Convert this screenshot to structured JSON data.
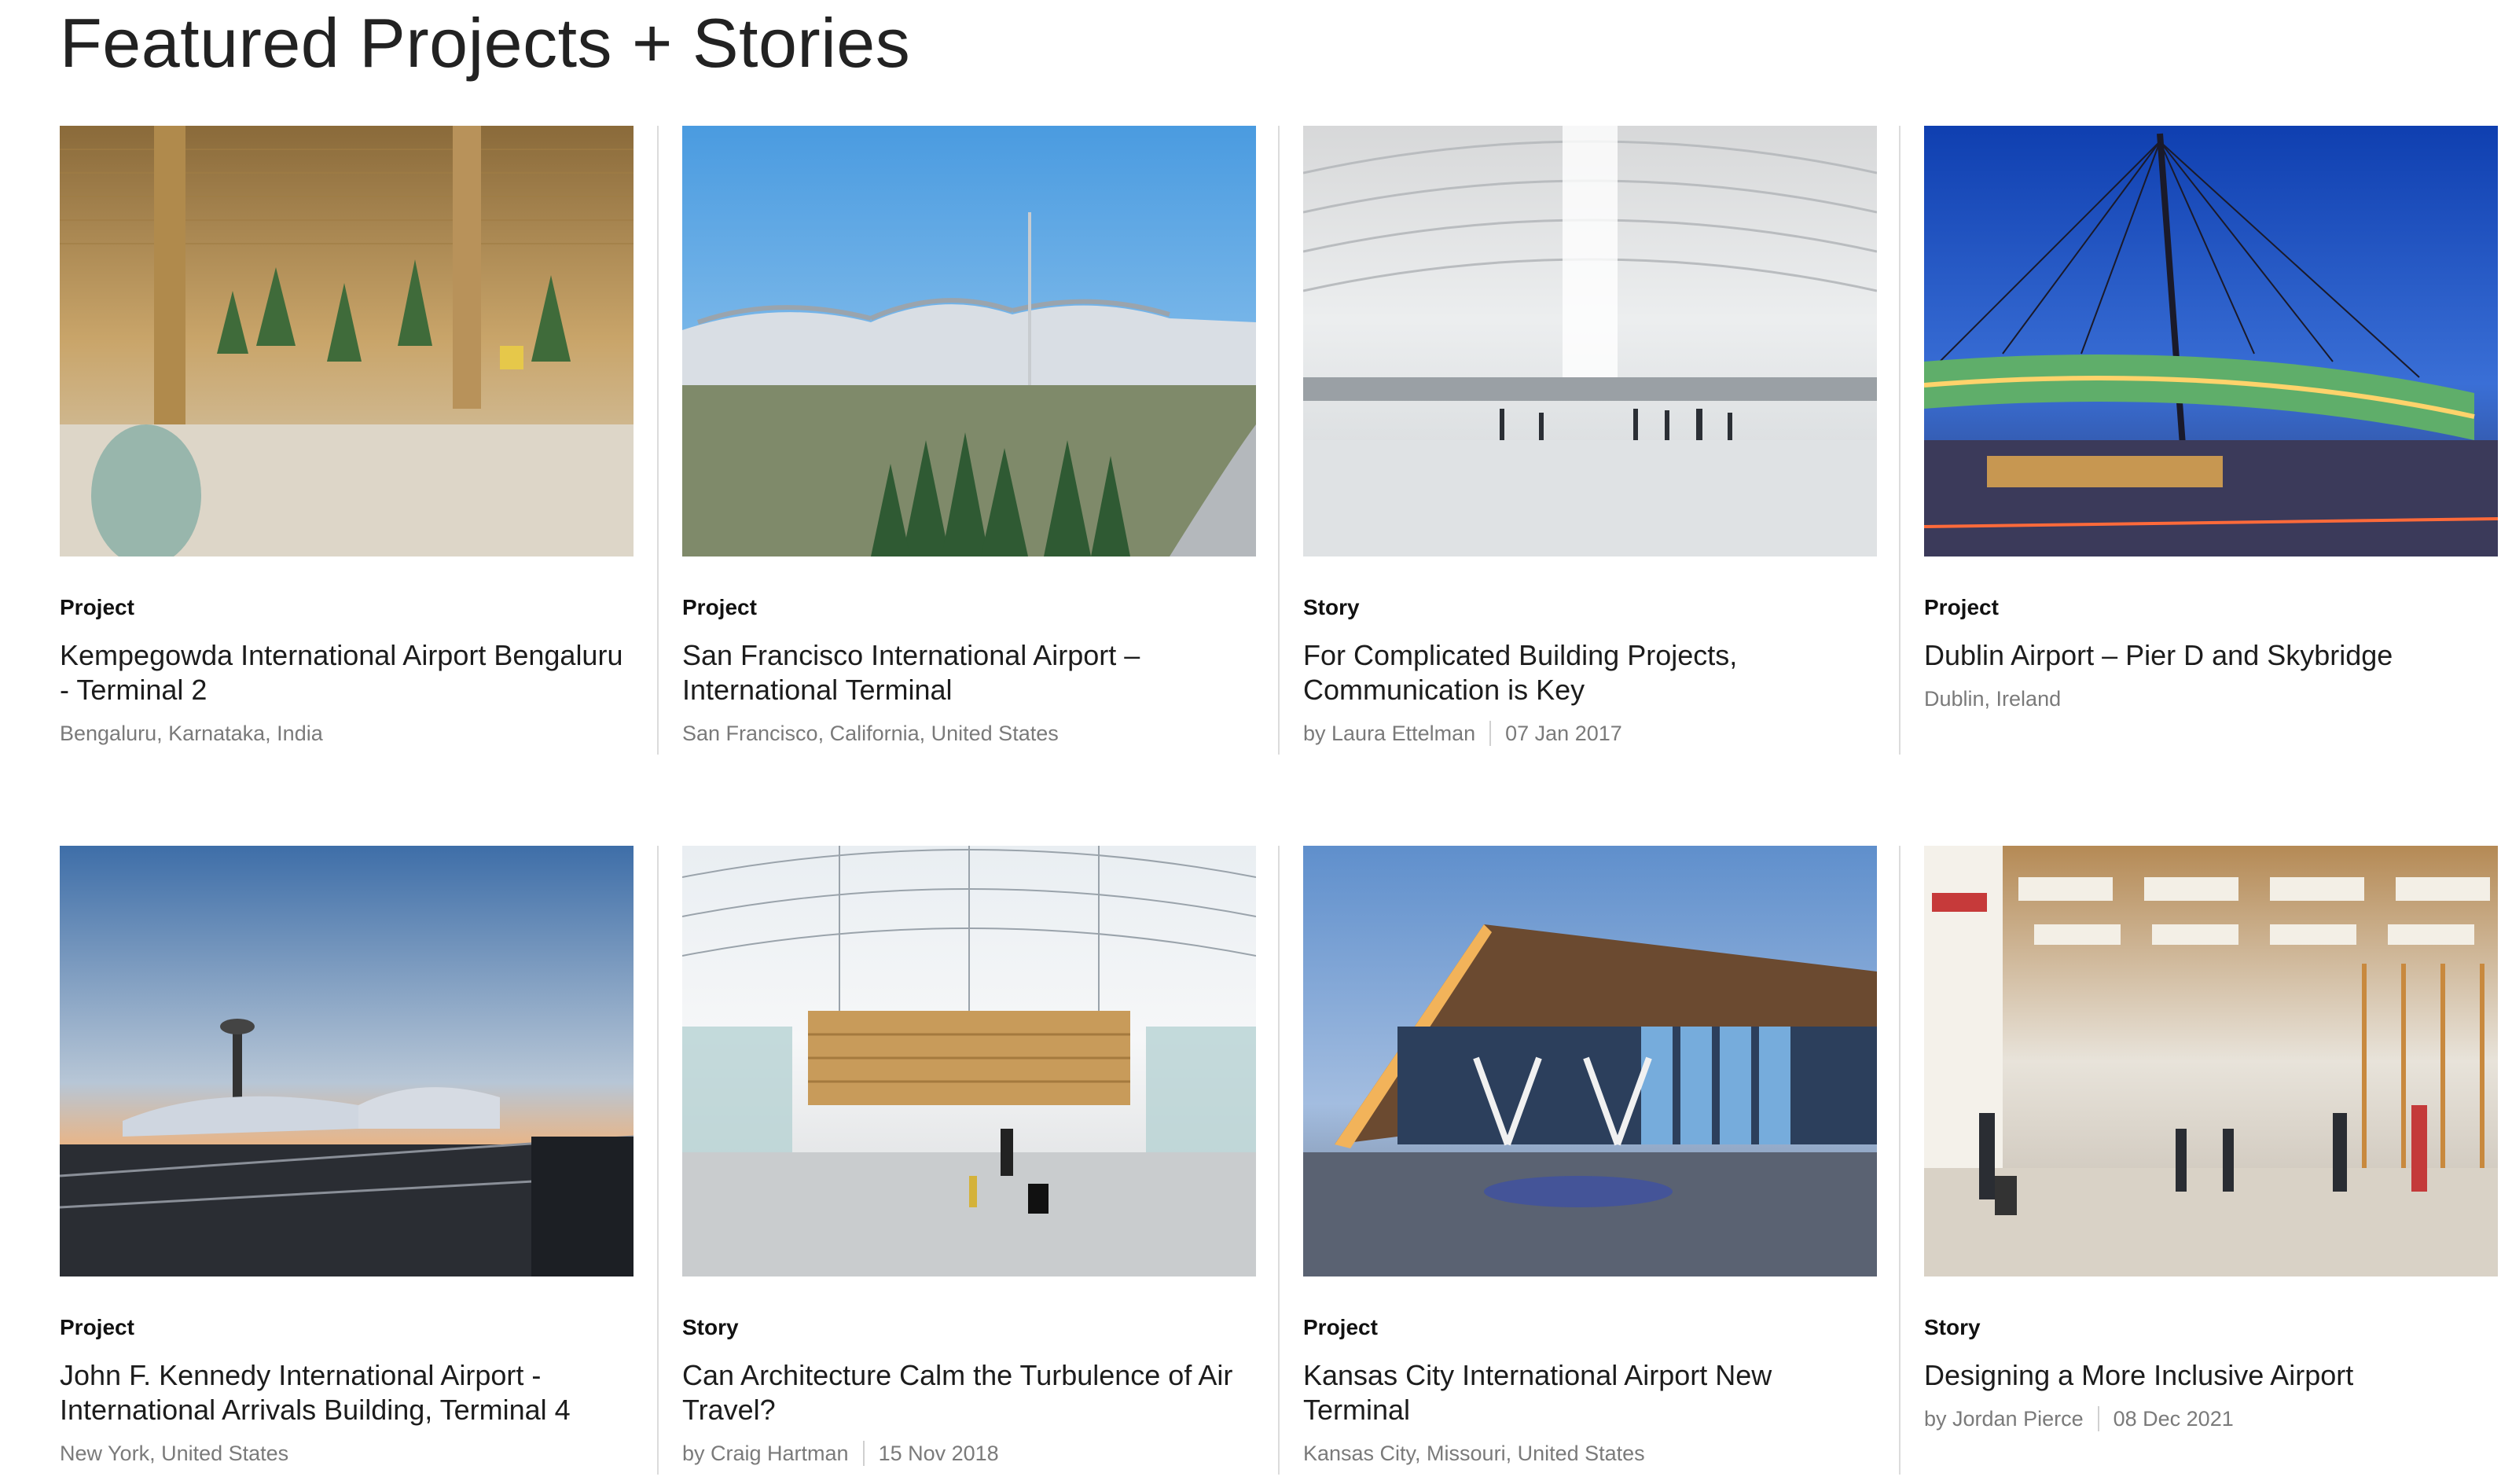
{
  "page": {
    "title": "Featured Projects + Stories"
  },
  "cards": [
    {
      "kind": "Project",
      "title": "Kempegowda International Airport Bengaluru - Terminal 2",
      "location": "Bengaluru, Karnataka, India"
    },
    {
      "kind": "Project",
      "title": "San Francisco International Airport – International Terminal",
      "location": "San Francisco, California, United States"
    },
    {
      "kind": "Story",
      "title": "For Complicated Building Projects, Communication is Key",
      "author": "by Laura Ettelman",
      "date": "07 Jan 2017"
    },
    {
      "kind": "Project",
      "title": "Dublin Airport – Pier D and Skybridge",
      "location": "Dublin, Ireland"
    },
    {
      "kind": "Project",
      "title": "John F. Kennedy International Airport - International Arrivals Building, Terminal 4",
      "location": "New York, United States"
    },
    {
      "kind": "Story",
      "title": "Can Architecture Calm the Turbulence of Air Travel?",
      "author": "by Craig Hartman",
      "date": "15 Nov 2018"
    },
    {
      "kind": "Project",
      "title": "Kansas City International Airport New Terminal",
      "location": "Kansas City, Missouri, United States"
    },
    {
      "kind": "Story",
      "title": "Designing a More Inclusive Airport",
      "author": "by Jordan Pierce",
      "date": "08 Dec 2021"
    }
  ]
}
